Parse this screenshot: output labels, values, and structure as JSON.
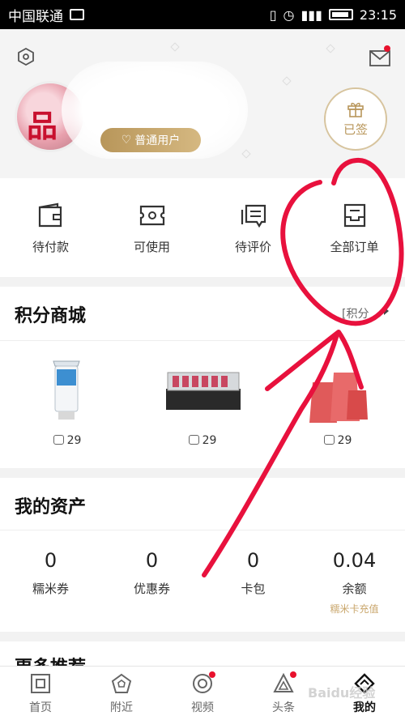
{
  "status_bar": {
    "carrier": "中国联通",
    "time": "23:15"
  },
  "header": {
    "badge": "普通用户",
    "signin": "已签"
  },
  "orders": [
    {
      "label": "待付款",
      "icon": "wallet-icon"
    },
    {
      "label": "可使用",
      "icon": "ticket-icon"
    },
    {
      "label": "待评价",
      "icon": "comment-icon"
    },
    {
      "label": "全部订单",
      "icon": "order-box-icon"
    }
  ],
  "mall": {
    "title": "积分商城",
    "more": "[积分",
    "products": [
      {
        "price": "29"
      },
      {
        "price": "29"
      },
      {
        "price": "29"
      }
    ]
  },
  "assets": {
    "title": "我的资产",
    "items": [
      {
        "value": "0",
        "label": "糯米券"
      },
      {
        "value": "0",
        "label": "优惠券"
      },
      {
        "value": "0",
        "label": "卡包"
      },
      {
        "value": "0.04",
        "label": "余额",
        "sub": "糯米卡充值"
      }
    ]
  },
  "more_rec": "更多推荐",
  "tabs": [
    {
      "label": "首页",
      "icon": "home-icon"
    },
    {
      "label": "附近",
      "icon": "nearby-icon"
    },
    {
      "label": "视频",
      "icon": "video-icon"
    },
    {
      "label": "头条",
      "icon": "headline-icon"
    },
    {
      "label": "我的",
      "icon": "mine-icon"
    }
  ],
  "watermark": "Baidu经验",
  "colors": {
    "accent_gold": "#b8965a",
    "red_dot": "#e8112d",
    "annotation": "#e8113d"
  }
}
